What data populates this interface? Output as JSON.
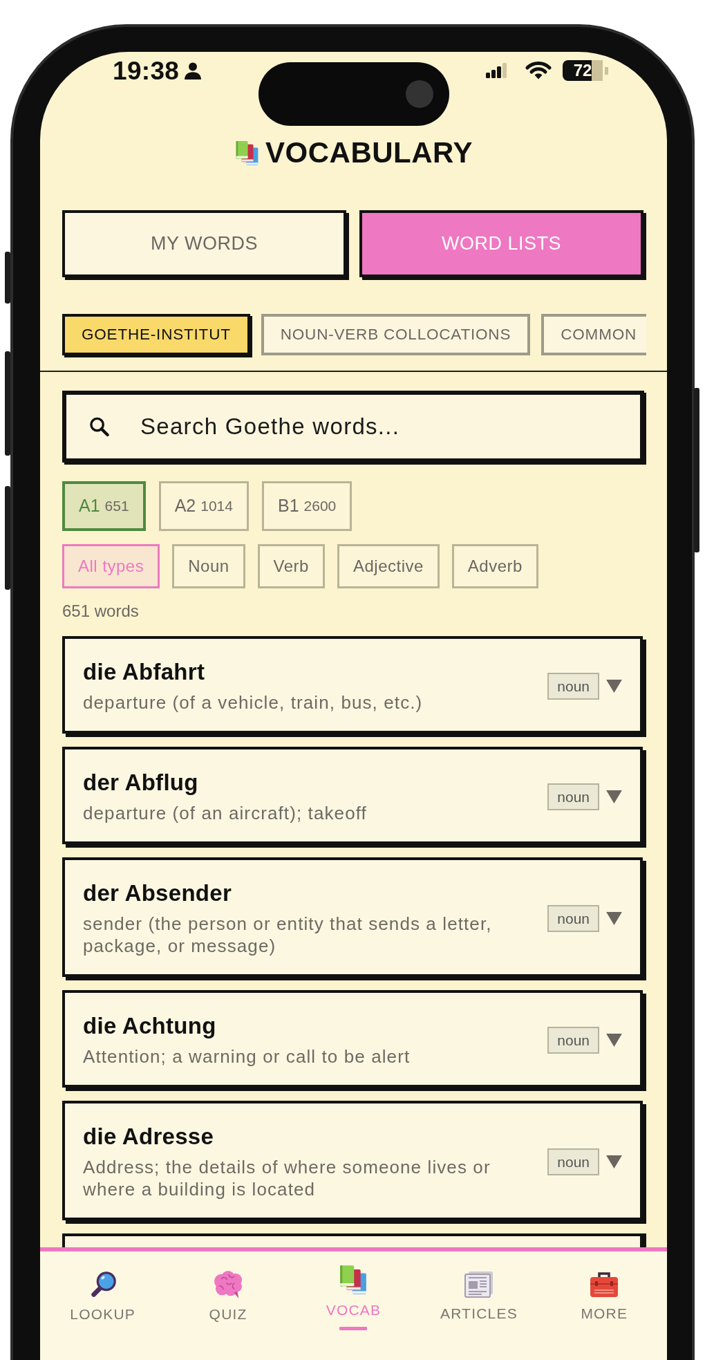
{
  "status_bar": {
    "time": "19:38",
    "battery": "72"
  },
  "header": {
    "title": "VOCABULARY"
  },
  "tabs": [
    {
      "label": "MY WORDS",
      "selected": false
    },
    {
      "label": "WORD LISTS",
      "selected": true
    }
  ],
  "word_lists": [
    {
      "label": "GOETHE-INSTITUT",
      "selected": true
    },
    {
      "label": "NOUN-VERB COLLOCATIONS",
      "selected": false
    },
    {
      "label": "COMMON",
      "selected": false
    }
  ],
  "search": {
    "placeholder": "Search Goethe words..."
  },
  "levels": [
    {
      "label": "A1",
      "count": "651",
      "selected": true
    },
    {
      "label": "A2",
      "count": "1014",
      "selected": false
    },
    {
      "label": "B1",
      "count": "2600",
      "selected": false
    }
  ],
  "types": [
    {
      "label": "All types",
      "selected": true
    },
    {
      "label": "Noun",
      "selected": false
    },
    {
      "label": "Verb",
      "selected": false
    },
    {
      "label": "Adjective",
      "selected": false
    },
    {
      "label": "Adverb",
      "selected": false
    }
  ],
  "result_count": "651 words",
  "words": [
    {
      "word": "die Abfahrt",
      "definition": "departure (of a vehicle, train, bus, etc.)",
      "type": "noun",
      "expanded": false
    },
    {
      "word": "der Abflug",
      "definition": "departure (of an aircraft); takeoff",
      "type": "noun",
      "expanded": false
    },
    {
      "word": "der Absender",
      "definition": "sender (the person or entity that sends a letter, package, or message)",
      "type": "noun",
      "expanded": false
    },
    {
      "word": "die Achtung",
      "definition": "Attention; a warning or call to be alert",
      "type": "noun",
      "expanded": false
    },
    {
      "word": "die Adresse",
      "definition": "Address; the details of where someone lives or where a building is located",
      "type": "noun",
      "expanded": false
    }
  ],
  "bottom_nav": [
    {
      "label": "LOOKUP",
      "selected": false
    },
    {
      "label": "QUIZ",
      "selected": false
    },
    {
      "label": "VOCAB",
      "selected": true
    },
    {
      "label": "ARTICLES",
      "selected": false
    },
    {
      "label": "MORE",
      "selected": false
    }
  ]
}
